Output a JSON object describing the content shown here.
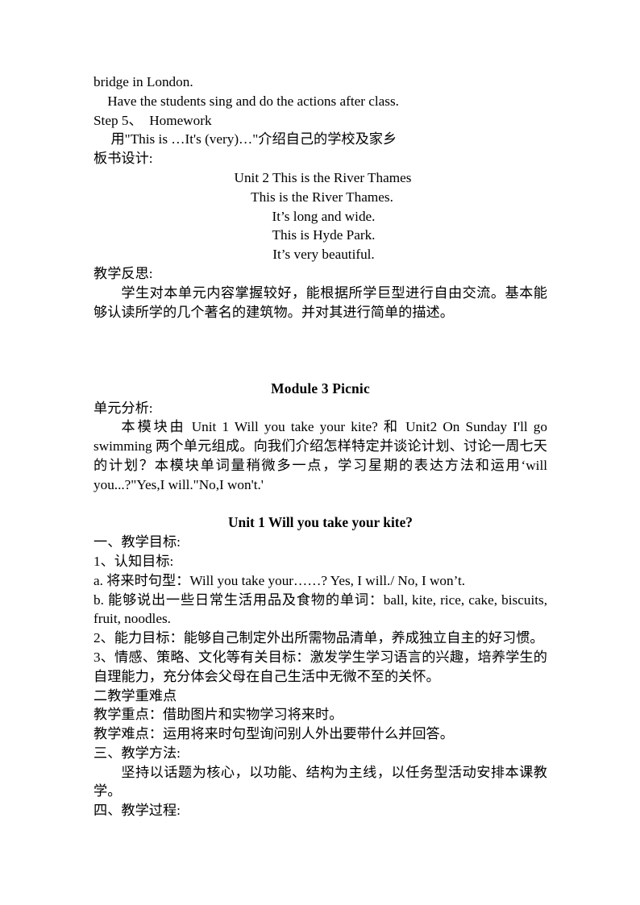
{
  "document": {
    "type": "lesson-plan",
    "language": "zh-CN + en",
    "page_background": "#ffffff",
    "text_color": "#000000"
  },
  "section_prev_unit": {
    "line_bridge": "bridge in London.",
    "line_have": "    Have the students sing and do the actions after class.",
    "line_step5": "Step 5、  Homework",
    "line_homework_task": "     用\"This is …It's (very)…\"介绍自己的学校及家乡",
    "label_board_design": "板书设计:"
  },
  "board_design": {
    "title": "Unit 2    This is the River Thames",
    "lines": [
      "This is the River Thames.",
      "It’s long and wide.",
      "This is Hyde Park.",
      "It’s very beautiful."
    ]
  },
  "teaching_reflection": {
    "label": "教学反思:",
    "body": "学生对本单元内容掌握较好，能根据所学巨型进行自由交流。基本能够认读所学的几个著名的建筑物。并对其进行简单的描述。"
  },
  "module": {
    "heading": "Module 3    Picnic",
    "analysis_label": "单元分析:",
    "analysis_body": "本模块由 Unit 1 Will you take your kite? 和 Unit2 On Sunday I'll go swimming 两个单元组成。向我们介绍怎样特定并谈论计划、讨论一周七天的计划？本模块单词量稍微多一点，学习星期的表达方法和运用‘will you...?\"Yes,I will.\"No,I won't.'"
  },
  "unit": {
    "heading": "Unit 1 Will you take your kite?",
    "objectives_label": "一、教学目标:",
    "cognitive_label": "1、认知目标:",
    "item_a": "a. 将来时句型：Will you take your……? Yes, I will./ No, I won’t.",
    "item_b": "b. 能够说出一些日常生活用品及食物的单词：ball, kite, rice, cake, biscuits, fruit, noodles.",
    "item_2": "2、能力目标：能够自己制定外出所需物品清单，养成独立自主的好习惯。",
    "item_3": "3、情感、策略、文化等有关目标：激发学生学习语言的兴趣，培养学生的自理能力，充分体会父母在自己生活中无微不至的关怀。",
    "difficulties_label": "二教学重难点",
    "key_point": "教学重点：借助图片和实物学习将来时。",
    "hard_point": "教学难点：运用将来时句型询问别人外出要带什么并回答。",
    "methods_label": "三、教学方法:",
    "methods_body": "坚持以话题为核心，以功能、结构为主线，以任务型活动安排本课教学。",
    "process_label": "四、教学过程:"
  }
}
